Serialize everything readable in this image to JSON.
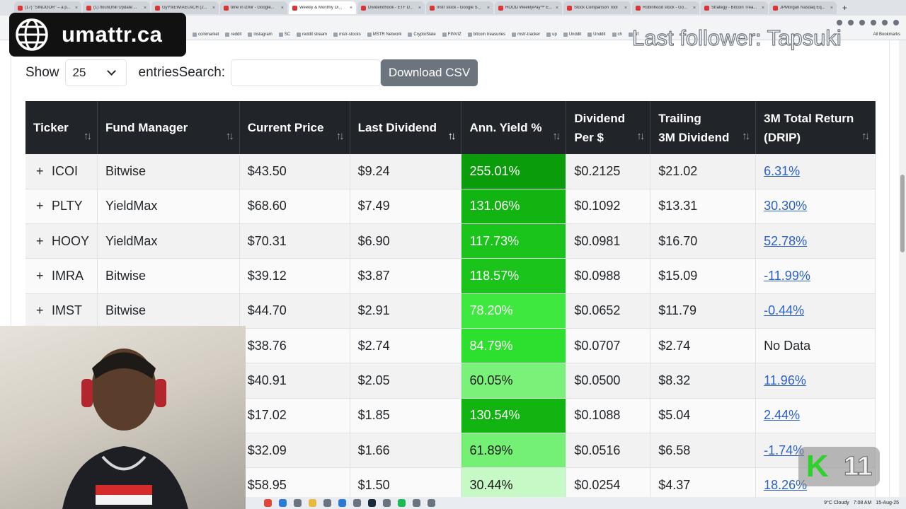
{
  "browser": {
    "tabs": [
      {
        "title": "(17) \"SINDOOR\" – a p...",
        "active": false
      },
      {
        "title": "(1) flounDhill Update:...",
        "active": false
      },
      {
        "title": "GyYtkEWIAEUsCH (2...",
        "active": false
      },
      {
        "title": "time in izmir - Google...",
        "active": false
      },
      {
        "title": "Weekly & Monthly Di...",
        "active": true
      },
      {
        "title": "Dividendhook - ETF D...",
        "active": false
      },
      {
        "title": "mstr stock - Google S...",
        "active": false
      },
      {
        "title": "HOOD WeeklyPay™ E...",
        "active": false
      },
      {
        "title": "Stock Comparison Tool",
        "active": false
      },
      {
        "title": "Robinhood stock - Go...",
        "active": false
      },
      {
        "title": "Strategy - Bitcoin Trea...",
        "active": false
      },
      {
        "title": "JPMorgan Nasdaq Eq...",
        "active": false
      }
    ],
    "new_tab_symbol": "+",
    "bookmarks": [
      "coinmarket",
      "reddit",
      "instagram",
      "SC",
      "reddit stream",
      "mstr-stocks",
      "MSTR Network",
      "CryptoSlate",
      "FINVIZ",
      "bitcoin treasuries",
      "mstr-tracker",
      "up",
      "Unddit",
      "Unddit",
      "ch",
      "aif"
    ],
    "all_bookmarks": "All Bookmarks"
  },
  "controls": {
    "show_label": "Show",
    "entries_value": "25",
    "entries_label": "entries",
    "search_label": "Search:",
    "search_value": "",
    "download_label": "Download CSV"
  },
  "table": {
    "columns": [
      {
        "line1": "Ticker",
        "line2": "",
        "sort_active": false
      },
      {
        "line1": "Fund Manager",
        "line2": "",
        "sort_active": false
      },
      {
        "line1": "Current Price",
        "line2": "",
        "sort_active": false
      },
      {
        "line1": "Last Dividend",
        "line2": "",
        "sort_active": true
      },
      {
        "line1": "Ann. Yield %",
        "line2": "",
        "sort_active": false
      },
      {
        "line1": "Dividend",
        "line2": "Per $",
        "sort_active": false
      },
      {
        "line1": "Trailing",
        "line2": "3M Dividend",
        "sort_active": false
      },
      {
        "line1": "3M Total Return",
        "line2": "(DRIP)",
        "sort_active": false
      }
    ],
    "rows": [
      {
        "expander": "+",
        "ticker": "ICOI",
        "manager": "Bitwise",
        "price": "$43.50",
        "last_div": "$9.24",
        "yield": "255.01%",
        "yield_color": "#0a9c0a",
        "per_dollar": "$0.2125",
        "trailing": "$21.02",
        "ret": "6.31%",
        "ret_link": true
      },
      {
        "expander": "+",
        "ticker": "PLTY",
        "manager": "YieldMax",
        "price": "$68.60",
        "last_div": "$7.49",
        "yield": "131.06%",
        "yield_color": "#11b411",
        "per_dollar": "$0.1092",
        "trailing": "$13.31",
        "ret": "30.30%",
        "ret_link": true
      },
      {
        "expander": "+",
        "ticker": "HOOY",
        "manager": "YieldMax",
        "price": "$70.31",
        "last_div": "$6.90",
        "yield": "117.73%",
        "yield_color": "#1bc41b",
        "per_dollar": "$0.0981",
        "trailing": "$16.70",
        "ret": "52.78%",
        "ret_link": true
      },
      {
        "expander": "+",
        "ticker": "IMRA",
        "manager": "Bitwise",
        "price": "$39.12",
        "last_div": "$3.87",
        "yield": "118.57%",
        "yield_color": "#1bc41b",
        "per_dollar": "$0.0988",
        "trailing": "$15.09",
        "ret": "-11.99%",
        "ret_link": true
      },
      {
        "expander": "+",
        "ticker": "IMST",
        "manager": "Bitwise",
        "price": "$44.70",
        "last_div": "$2.91",
        "yield": "78.20%",
        "yield_color": "#3ee83e",
        "per_dollar": "$0.0652",
        "trailing": "$11.79",
        "ret": "-0.44%",
        "ret_link": true
      },
      {
        "expander": "",
        "ticker": "",
        "manager": "",
        "price": "$38.76",
        "last_div": "$2.74",
        "yield": "84.79%",
        "yield_color": "#2ee02e",
        "per_dollar": "$0.0707",
        "trailing": "$2.74",
        "ret": "No Data",
        "ret_link": false
      },
      {
        "expander": "",
        "ticker": "",
        "manager": "",
        "price": "$40.91",
        "last_div": "$2.05",
        "yield": "60.05%",
        "yield_color": "#7af27a",
        "per_dollar": "$0.0500",
        "trailing": "$8.32",
        "ret": "11.96%",
        "ret_link": true
      },
      {
        "expander": "",
        "ticker": "",
        "manager": "",
        "price": "$17.02",
        "last_div": "$1.85",
        "yield": "130.54%",
        "yield_color": "#11b411",
        "per_dollar": "$0.1088",
        "trailing": "$5.04",
        "ret": "2.44%",
        "ret_link": true
      },
      {
        "expander": "",
        "ticker": "",
        "manager": "",
        "price": "$32.09",
        "last_div": "$1.66",
        "yield": "61.89%",
        "yield_color": "#74f074",
        "per_dollar": "$0.0516",
        "trailing": "$6.58",
        "ret": "-1.74%",
        "ret_link": true
      },
      {
        "expander": "",
        "ticker": "",
        "manager": "",
        "price": "$58.95",
        "last_div": "$1.50",
        "yield": "30.44%",
        "yield_color": "#c6f9c6",
        "per_dollar": "$0.0254",
        "trailing": "$4.37",
        "ret": "18.26%",
        "ret_link": true
      }
    ]
  },
  "overlay": {
    "logo_text": "umattr.ca",
    "follower_text": "Last follower: Tapsuki",
    "badge_letter": "K",
    "badge_number": "11"
  },
  "taskbar": {
    "weather": "9°C Cloudy",
    "time": "7:08 AM",
    "date": "15-Aug-25"
  }
}
